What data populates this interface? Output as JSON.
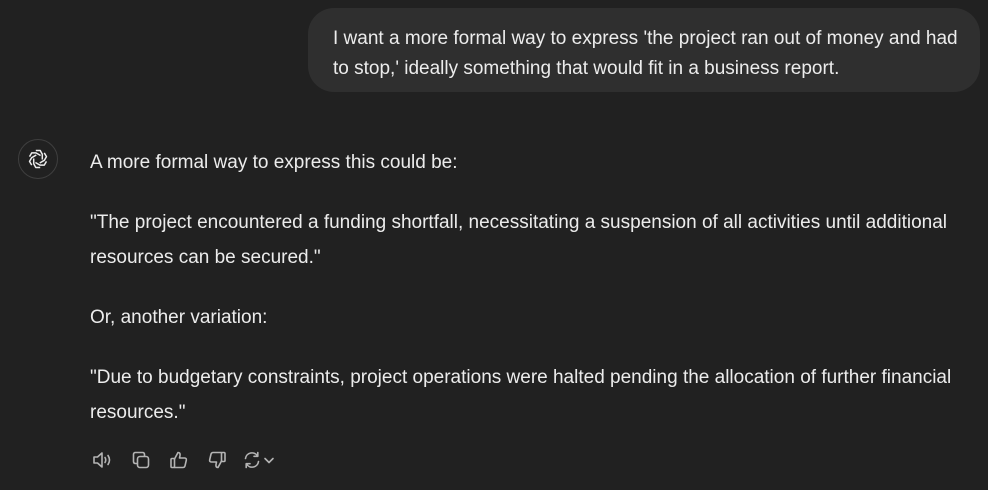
{
  "user_message": {
    "text": "I want a more formal way to express 'the project ran out of money and had to stop,' ideally something that would fit in a business report."
  },
  "assistant": {
    "avatar_icon": "openai-logo-icon",
    "paragraphs": [
      "A more formal way to express this could be:",
      "\"The project encountered a funding shortfall, necessitating a suspension of all activities until additional resources can be secured.\"",
      "Or, another variation:",
      "\"Due to budgetary constraints, project operations were halted pending the allocation of further financial resources.\""
    ]
  },
  "action_bar": {
    "icons": [
      "read-aloud-icon",
      "copy-icon",
      "thumbs-up-icon",
      "thumbs-down-icon",
      "regenerate-icon",
      "chevron-down-icon"
    ]
  },
  "colors": {
    "background": "#212121",
    "user_bubble": "#2f2f2f",
    "text": "#ececec",
    "icon": "#b4b4b4"
  }
}
